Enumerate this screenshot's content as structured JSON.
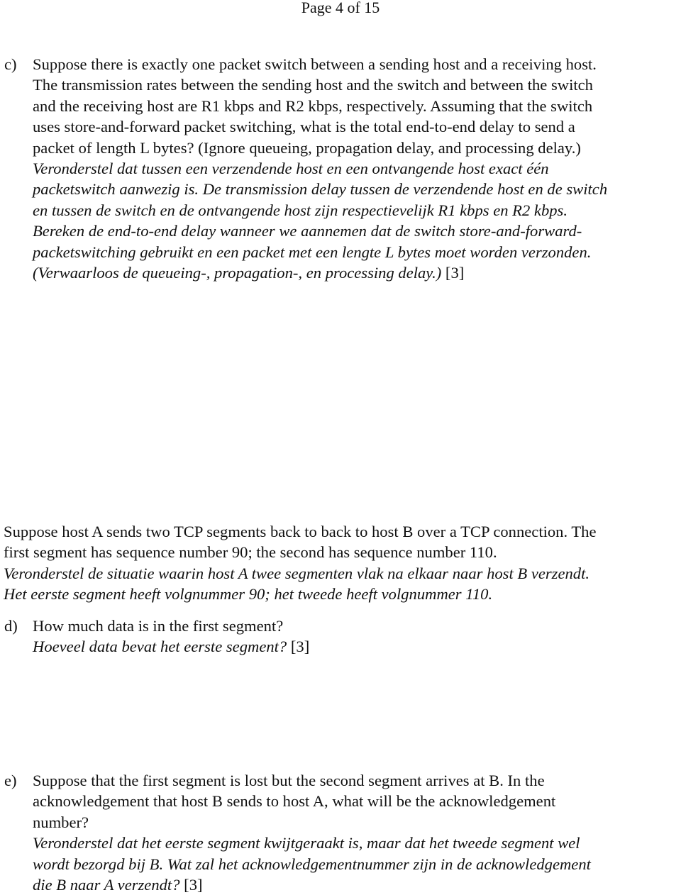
{
  "header": {
    "page_label": "Page 4 of 15"
  },
  "question_c": {
    "label": "c)",
    "english_lines": [
      "Suppose there is exactly one packet switch between a sending host and a receiving host.",
      "The transmission rates between the sending host and the switch and between the switch",
      "and the receiving host are R1 kbps and R2 kbps, respectively. Assuming that the switch",
      "uses store-and-forward packet switching, what is the total end-to-end delay to send a",
      "packet of length L bytes? (Ignore queueing, propagation delay, and processing delay.)"
    ],
    "dutch_lines": [
      "Veronderstel dat tussen een verzendende host en een ontvangende host exact één",
      "packetswitch aanwezig is. De transmission delay tussen de verzendende host en de switch",
      "en tussen de switch en de ontvangende host zijn respectievelijk R1 kbps en R2 kbps.",
      "Bereken de end-to-end delay wanneer we aannemen dat de switch store-and-forward-",
      "packetswitching gebruikt en een packet met een lengte L bytes moet worden verzonden.",
      "(Verwaarloos de queueing-, propagation-, en processing delay.)"
    ],
    "points": "[3]"
  },
  "tcp_intro": {
    "english_lines": [
      "Suppose host A sends two TCP segments back to back to host B over a TCP connection. The",
      "first segment has sequence number 90; the second has sequence number 110."
    ],
    "dutch_lines": [
      "Veronderstel de situatie waarin host A twee segmenten vlak na elkaar naar host B verzendt.",
      "Het eerste segment heeft volgnummer 90; het tweede heeft volgnummer 110."
    ]
  },
  "question_d": {
    "label": "d)",
    "english_lines": [
      "How much data is in the first segment?"
    ],
    "dutch_lines": [
      "Hoeveel data bevat het eerste segment?"
    ],
    "points": "[3]"
  },
  "question_e": {
    "label": "e)",
    "english_lines": [
      "Suppose that the first segment is lost but the second segment arrives at B. In the",
      "acknowledgement that host B sends to host A, what will be the acknowledgement",
      "number?"
    ],
    "dutch_lines": [
      "Veronderstel dat het eerste segment kwijtgeraakt is, maar dat het tweede segment wel",
      "wordt bezorgd bij B. Wat zal het acknowledgementnummer zijn in de acknowledgement",
      "die B naar A verzendt?"
    ],
    "points": "[3]"
  }
}
